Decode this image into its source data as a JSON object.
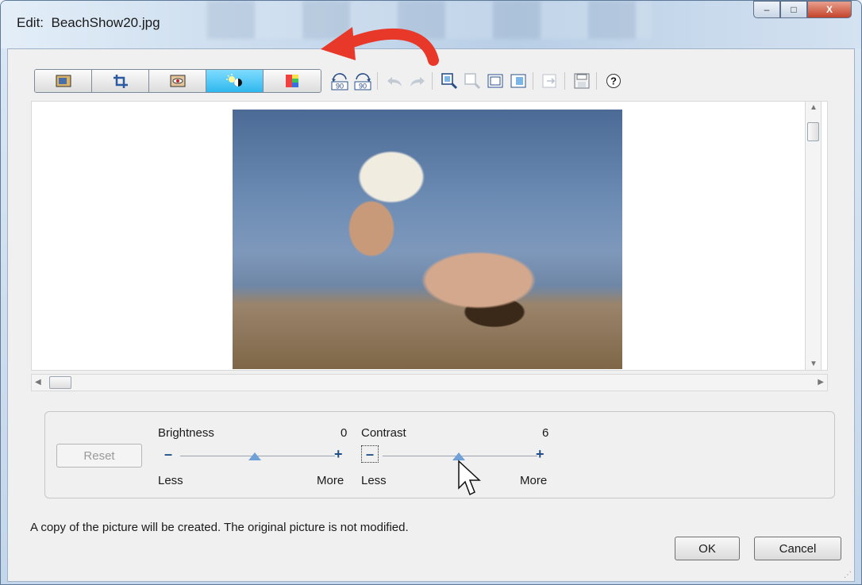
{
  "window": {
    "title_prefix": "Edit:",
    "filename": "BeachShow20.jpg"
  },
  "titlebar_buttons": {
    "minimize": "–",
    "maximize": "□",
    "close": "X"
  },
  "toolbar": {
    "tabs": [
      {
        "name": "auto-fix-tab"
      },
      {
        "name": "crop-tab"
      },
      {
        "name": "red-eye-tab"
      },
      {
        "name": "brightness-contrast-tab",
        "active": true
      },
      {
        "name": "color-tab"
      }
    ],
    "rotate_left_label": "90",
    "rotate_right_label": "90",
    "help_label": "?"
  },
  "adjust": {
    "reset_label": "Reset",
    "brightness": {
      "label": "Brightness",
      "value": "0",
      "less": "Less",
      "more": "More",
      "level": 0
    },
    "contrast": {
      "label": "Contrast",
      "value": "6",
      "less": "Less",
      "more": "More",
      "level": 6
    }
  },
  "footer": {
    "note": "A copy of the picture will be created. The original picture is not modified.",
    "ok_label": "OK",
    "cancel_label": "Cancel"
  },
  "colors": {
    "active_tab": "#2fb8ee",
    "annotation_arrow": "#e8382a"
  }
}
